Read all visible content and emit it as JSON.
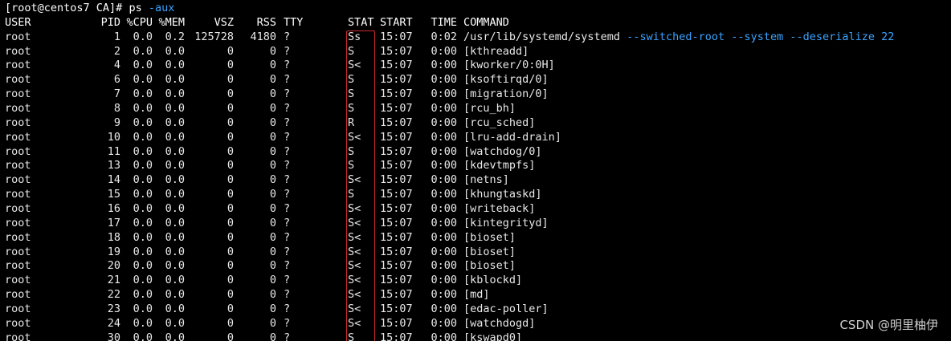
{
  "terminal": {
    "prompt": "[root@centos7 CA]# ",
    "command": "ps",
    "arg": " -aux"
  },
  "header": {
    "user": "USER",
    "pid": "PID",
    "cpu": "%CPU",
    "mem": "%MEM",
    "vsz": "VSZ",
    "rss": "RSS",
    "tty": "TTY",
    "stat": "STAT",
    "start": "START",
    "time": "TIME",
    "command": "COMMAND"
  },
  "rows": [
    {
      "user": "root",
      "pid": "1",
      "cpu": "0.0",
      "mem": "0.2",
      "vsz": "125728",
      "rss": "4180",
      "tty": "?",
      "stat": "Ss",
      "start": "15:07",
      "time": "0:02",
      "command": "/usr/lib/systemd/systemd ",
      "opts": "--switched-root --system --deserialize 22"
    },
    {
      "user": "root",
      "pid": "2",
      "cpu": "0.0",
      "mem": "0.0",
      "vsz": "0",
      "rss": "0",
      "tty": "?",
      "stat": "S",
      "start": "15:07",
      "time": "0:00",
      "command": "[kthreadd]",
      "opts": ""
    },
    {
      "user": "root",
      "pid": "4",
      "cpu": "0.0",
      "mem": "0.0",
      "vsz": "0",
      "rss": "0",
      "tty": "?",
      "stat": "S<",
      "start": "15:07",
      "time": "0:00",
      "command": "[kworker/0:0H]",
      "opts": ""
    },
    {
      "user": "root",
      "pid": "6",
      "cpu": "0.0",
      "mem": "0.0",
      "vsz": "0",
      "rss": "0",
      "tty": "?",
      "stat": "S",
      "start": "15:07",
      "time": "0:00",
      "command": "[ksoftirqd/0]",
      "opts": ""
    },
    {
      "user": "root",
      "pid": "7",
      "cpu": "0.0",
      "mem": "0.0",
      "vsz": "0",
      "rss": "0",
      "tty": "?",
      "stat": "S",
      "start": "15:07",
      "time": "0:00",
      "command": "[migration/0]",
      "opts": ""
    },
    {
      "user": "root",
      "pid": "8",
      "cpu": "0.0",
      "mem": "0.0",
      "vsz": "0",
      "rss": "0",
      "tty": "?",
      "stat": "S",
      "start": "15:07",
      "time": "0:00",
      "command": "[rcu_bh]",
      "opts": ""
    },
    {
      "user": "root",
      "pid": "9",
      "cpu": "0.0",
      "mem": "0.0",
      "vsz": "0",
      "rss": "0",
      "tty": "?",
      "stat": "R",
      "start": "15:07",
      "time": "0:00",
      "command": "[rcu_sched]",
      "opts": ""
    },
    {
      "user": "root",
      "pid": "10",
      "cpu": "0.0",
      "mem": "0.0",
      "vsz": "0",
      "rss": "0",
      "tty": "?",
      "stat": "S<",
      "start": "15:07",
      "time": "0:00",
      "command": "[lru-add-drain]",
      "opts": ""
    },
    {
      "user": "root",
      "pid": "11",
      "cpu": "0.0",
      "mem": "0.0",
      "vsz": "0",
      "rss": "0",
      "tty": "?",
      "stat": "S",
      "start": "15:07",
      "time": "0:00",
      "command": "[watchdog/0]",
      "opts": ""
    },
    {
      "user": "root",
      "pid": "13",
      "cpu": "0.0",
      "mem": "0.0",
      "vsz": "0",
      "rss": "0",
      "tty": "?",
      "stat": "S",
      "start": "15:07",
      "time": "0:00",
      "command": "[kdevtmpfs]",
      "opts": ""
    },
    {
      "user": "root",
      "pid": "14",
      "cpu": "0.0",
      "mem": "0.0",
      "vsz": "0",
      "rss": "0",
      "tty": "?",
      "stat": "S<",
      "start": "15:07",
      "time": "0:00",
      "command": "[netns]",
      "opts": ""
    },
    {
      "user": "root",
      "pid": "15",
      "cpu": "0.0",
      "mem": "0.0",
      "vsz": "0",
      "rss": "0",
      "tty": "?",
      "stat": "S",
      "start": "15:07",
      "time": "0:00",
      "command": "[khungtaskd]",
      "opts": ""
    },
    {
      "user": "root",
      "pid": "16",
      "cpu": "0.0",
      "mem": "0.0",
      "vsz": "0",
      "rss": "0",
      "tty": "?",
      "stat": "S<",
      "start": "15:07",
      "time": "0:00",
      "command": "[writeback]",
      "opts": ""
    },
    {
      "user": "root",
      "pid": "17",
      "cpu": "0.0",
      "mem": "0.0",
      "vsz": "0",
      "rss": "0",
      "tty": "?",
      "stat": "S<",
      "start": "15:07",
      "time": "0:00",
      "command": "[kintegrityd]",
      "opts": ""
    },
    {
      "user": "root",
      "pid": "18",
      "cpu": "0.0",
      "mem": "0.0",
      "vsz": "0",
      "rss": "0",
      "tty": "?",
      "stat": "S<",
      "start": "15:07",
      "time": "0:00",
      "command": "[bioset]",
      "opts": ""
    },
    {
      "user": "root",
      "pid": "19",
      "cpu": "0.0",
      "mem": "0.0",
      "vsz": "0",
      "rss": "0",
      "tty": "?",
      "stat": "S<",
      "start": "15:07",
      "time": "0:00",
      "command": "[bioset]",
      "opts": ""
    },
    {
      "user": "root",
      "pid": "20",
      "cpu": "0.0",
      "mem": "0.0",
      "vsz": "0",
      "rss": "0",
      "tty": "?",
      "stat": "S<",
      "start": "15:07",
      "time": "0:00",
      "command": "[bioset]",
      "opts": ""
    },
    {
      "user": "root",
      "pid": "21",
      "cpu": "0.0",
      "mem": "0.0",
      "vsz": "0",
      "rss": "0",
      "tty": "?",
      "stat": "S<",
      "start": "15:07",
      "time": "0:00",
      "command": "[kblockd]",
      "opts": ""
    },
    {
      "user": "root",
      "pid": "22",
      "cpu": "0.0",
      "mem": "0.0",
      "vsz": "0",
      "rss": "0",
      "tty": "?",
      "stat": "S<",
      "start": "15:07",
      "time": "0:00",
      "command": "[md]",
      "opts": ""
    },
    {
      "user": "root",
      "pid": "23",
      "cpu": "0.0",
      "mem": "0.0",
      "vsz": "0",
      "rss": "0",
      "tty": "?",
      "stat": "S<",
      "start": "15:07",
      "time": "0:00",
      "command": "[edac-poller]",
      "opts": ""
    },
    {
      "user": "root",
      "pid": "24",
      "cpu": "0.0",
      "mem": "0.0",
      "vsz": "0",
      "rss": "0",
      "tty": "?",
      "stat": "S<",
      "start": "15:07",
      "time": "0:00",
      "command": "[watchdogd]",
      "opts": ""
    },
    {
      "user": "root",
      "pid": "30",
      "cpu": "0.0",
      "mem": "0.0",
      "vsz": "0",
      "rss": "0",
      "tty": "?",
      "stat": "S",
      "start": "15:07",
      "time": "0:00",
      "command": "[kswapd0]",
      "opts": ""
    }
  ],
  "watermark": "CSDN @明里柚伊",
  "colors": {
    "background": "#000000",
    "text": "#e8e8e8",
    "option": "#3ba3ff",
    "highlight_box": "#d12a2a"
  }
}
